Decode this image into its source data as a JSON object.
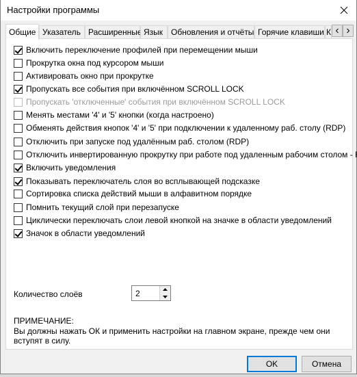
{
  "window": {
    "title": "Настройки программы"
  },
  "tabs": [
    {
      "label": "Общие"
    },
    {
      "label": "Указатель"
    },
    {
      "label": "Расширенные"
    },
    {
      "label": "Язык"
    },
    {
      "label": "Обновления и отчёты"
    },
    {
      "label": "Горячие клавиши"
    },
    {
      "label": "К"
    }
  ],
  "options": [
    {
      "label": "Включить переключение профилей при перемещении мыши",
      "checked": true,
      "enabled": true
    },
    {
      "label": "Прокрутка окна под курсором мыши",
      "checked": false,
      "enabled": true
    },
    {
      "label": "Активировать окно при прокрутке",
      "checked": false,
      "enabled": true
    },
    {
      "label": "Пропускать все события при включённом SCROLL LOCK",
      "checked": true,
      "enabled": true
    },
    {
      "label": "Пропускать 'отключенные' события при включённом SCROLL LOCK",
      "checked": false,
      "enabled": false
    },
    {
      "label": "Менять местами '4' и '5' кнопки (когда настроено)",
      "checked": false,
      "enabled": true
    },
    {
      "label": "Обменять действия кнопок '4' и '5' при подключении к удаленному раб. столу (RDP)",
      "checked": false,
      "enabled": true
    },
    {
      "label": "Отключить при запуске под удалённым раб. столом (RDP)",
      "checked": false,
      "enabled": true
    },
    {
      "label": "Отключить инвертированную прокрутку при работе под удаленным рабочим столом - RDP",
      "checked": false,
      "enabled": true
    },
    {
      "label": "Включить уведомления",
      "checked": true,
      "enabled": true
    },
    {
      "label": "Показывать переключатель слоя во всплывающей подсказке",
      "checked": true,
      "enabled": true
    },
    {
      "label": "Сортировка списка действий мыши в алфавитном порядке",
      "checked": false,
      "enabled": true
    },
    {
      "label": "Помнить текущий слой при перезапуске",
      "checked": false,
      "enabled": true
    },
    {
      "label": "Циклически переключать слои левой кнопкой на значке в области уведомлений",
      "checked": false,
      "enabled": true
    },
    {
      "label": "Значок в области уведомлений",
      "checked": true,
      "enabled": true
    }
  ],
  "layers": {
    "label": "Количество слоёв",
    "value": "2"
  },
  "note": {
    "title": "ПРИМЕЧАНИЕ:",
    "text": "Вы должны нажать ОК и применить настройки на главном экране, прежде чем они вступят в силу."
  },
  "buttons": {
    "ok": "OK",
    "cancel": "Отмена"
  }
}
